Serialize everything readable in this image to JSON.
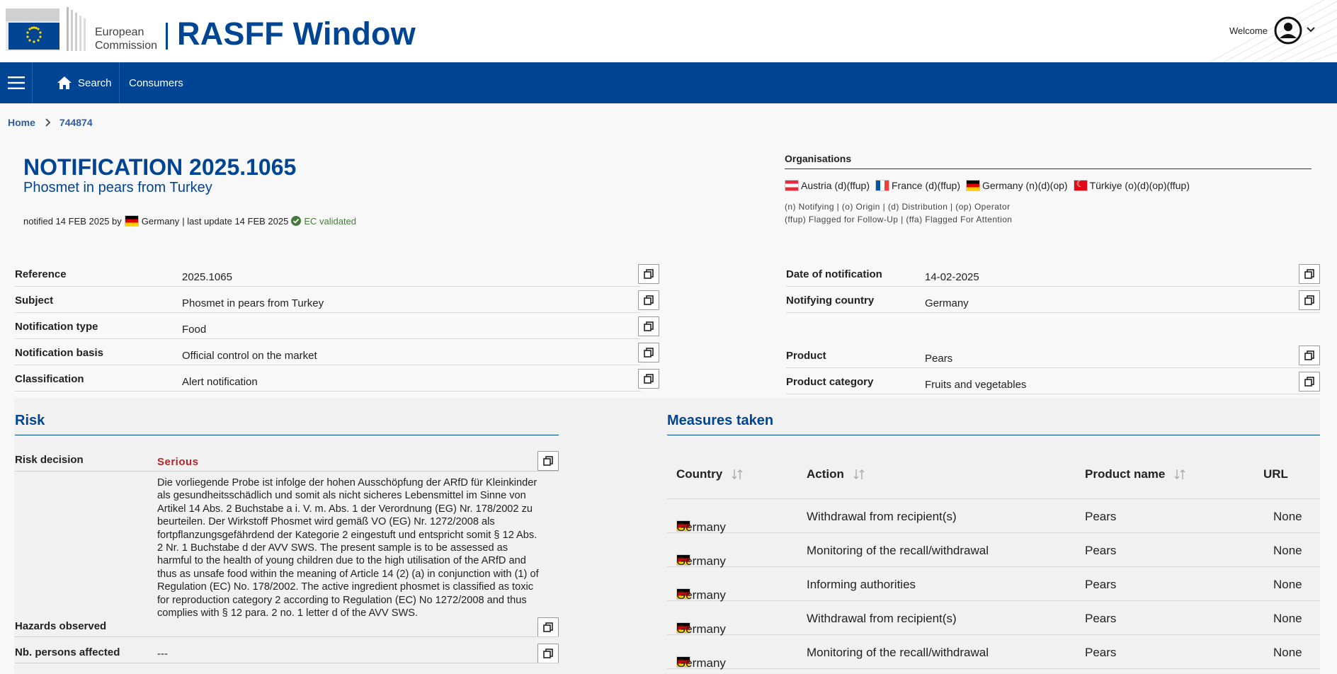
{
  "header": {
    "org_name_line1": "European",
    "org_name_line2": "Commission",
    "app_title": "RASFF Window",
    "welcome": "Welcome"
  },
  "nav": {
    "search": "Search",
    "consumers": "Consumers"
  },
  "breadcrumb": {
    "home": "Home",
    "current": "744874"
  },
  "notification": {
    "title": "NOTIFICATION 2025.1065",
    "subtitle": "Phosmet in pears from Turkey",
    "notified_prefix": "notified 14 FEB 2025 by",
    "notified_country": "Germany",
    "last_update": "| last update 14 FEB 2025",
    "validated": "EC validated"
  },
  "organisations": {
    "title": "Organisations",
    "items": [
      {
        "label": "Austria (d)(ffup)",
        "flag": "AT"
      },
      {
        "label": "France (d)(ffup)",
        "flag": "FR"
      },
      {
        "label": "Germany (n)(d)(op)",
        "flag": "DE"
      },
      {
        "label": "Türkiye (o)(d)(op)(ffup)",
        "flag": "TR"
      }
    ],
    "legend_line1": "(n) Notifying | (o) Origin | (d) Distribution | (op) Operator",
    "legend_line2": "(ffup) Flagged for Follow-Up | (ffa) Flagged For Attention"
  },
  "details_left": [
    {
      "label": "Reference",
      "value": "2025.1065"
    },
    {
      "label": "Subject",
      "value": "Phosmet in pears from Turkey"
    },
    {
      "label": "Notification type",
      "value": "Food"
    },
    {
      "label": "Notification basis",
      "value": "Official control on the market"
    },
    {
      "label": "Classification",
      "value": "Alert notification"
    }
  ],
  "details_right": [
    {
      "label": "Date of notification",
      "value": "14-02-2025"
    },
    {
      "label": "Notifying country",
      "value": "Germany"
    },
    {
      "label": "Product",
      "value": "Pears"
    },
    {
      "label": "Product category",
      "value": "Fruits and vegetables"
    }
  ],
  "risk": {
    "title": "Risk",
    "decision_label": "Risk decision",
    "decision_value": "Serious",
    "hazards_label": "Hazards observed",
    "hazards_text": "Die vorliegende Probe ist infolge der hohen Ausschöpfung der ARfD für Kleinkinder als gesundheitsschädlich und somit als nicht sicheres Lebensmittel im Sinne von Artikel 14 Abs. 2 Buchstabe a i. V. m. Abs. 1 der Verordnung (EG) Nr. 178/2002 zu beurteilen. Der Wirkstoff Phosmet wird gemäß VO (EG) Nr. 1272/2008 als fortpflanzungsgefährdend der Kategorie 2 eingestuft und entspricht somit § 12 Abs. 2 Nr. 1 Buchstabe d der AVV SWS. The present sample is to be assessed as harmful to the health of young children due to the high utilisation of the ARfD and thus as unsafe food within the meaning of Article 14 (2) (a) in conjunction with (1) of Regulation (EC) No. 178/2002. The active ingredient phosmet is classified as toxic for reproduction category 2 according to Regulation (EC) No 1272/2008 and thus complies with § 12 para. 2 no. 1 letter d of the AVV SWS.",
    "persons_label": "Nb. persons affected",
    "persons_value": "---"
  },
  "measures": {
    "title": "Measures taken",
    "columns": {
      "country": "Country",
      "action": "Action",
      "product": "Product name",
      "url": "URL"
    },
    "rows": [
      {
        "country": "Germany",
        "action": "Withdrawal from recipient(s)",
        "product": "Pears",
        "url": "None"
      },
      {
        "country": "Germany",
        "action": "Monitoring of the recall/withdrawal",
        "product": "Pears",
        "url": "None"
      },
      {
        "country": "Germany",
        "action": "Informing authorities",
        "product": "Pears",
        "url": "None"
      },
      {
        "country": "Germany",
        "action": "Withdrawal from recipient(s)",
        "product": "Pears",
        "url": "None"
      },
      {
        "country": "Germany",
        "action": "Monitoring of the recall/withdrawal",
        "product": "Pears",
        "url": "None"
      }
    ]
  },
  "colors": {
    "brand_blue": "#004494",
    "serious_red": "#b5252a",
    "validated_green": "#467a3c"
  }
}
